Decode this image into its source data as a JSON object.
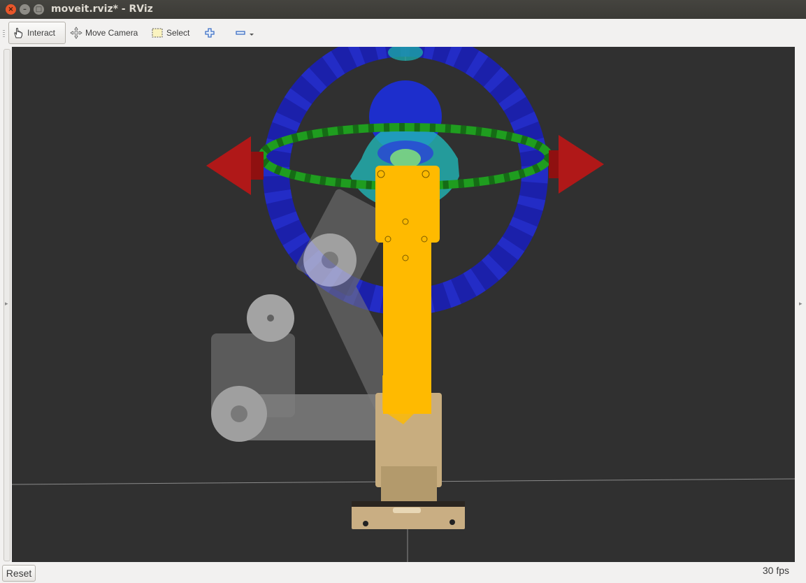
{
  "window": {
    "title": "moveit.rviz* - RViz",
    "close_glyph": "×",
    "minimize_glyph": "–",
    "maximize_glyph": "□"
  },
  "toolbar": {
    "tools": [
      {
        "label": "Interact",
        "icon": "hand-pointer-icon"
      },
      {
        "label": "Move Camera",
        "icon": "move-camera-icon"
      },
      {
        "label": "Select",
        "icon": "select-box-icon"
      },
      {
        "label": "",
        "icon": "add-tool-icon"
      },
      {
        "label": "",
        "icon": "remove-tool-icon"
      }
    ]
  },
  "status": {
    "reset_label": "Reset",
    "fps": "30 fps"
  },
  "colors": {
    "viewport_bg": "#303030",
    "robot_goal": "#ffba00",
    "robot_current": "#c8ad7f",
    "ring_blue": "#1a1fb8",
    "ring_green": "#1f9d1f",
    "arrow_red": "#b01818",
    "ghost": "#bfbfbf"
  }
}
